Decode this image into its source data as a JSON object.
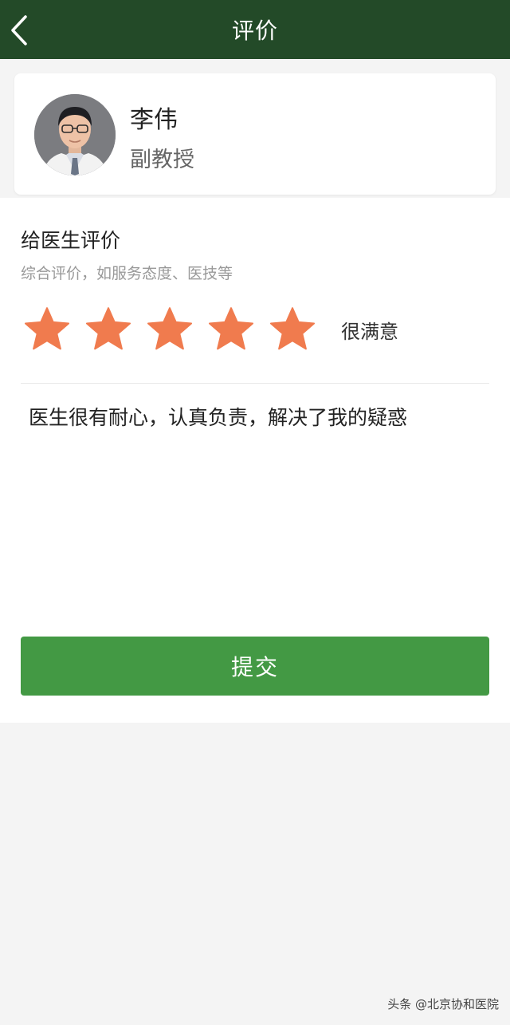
{
  "header": {
    "title": "评价",
    "back_icon": "chevron-left-icon"
  },
  "doctor": {
    "name": "李伟",
    "title": "副教授"
  },
  "rating": {
    "section_title": "给医生评价",
    "subtitle": "综合评价，如服务态度、医技等",
    "stars_selected": 5,
    "stars_total": 5,
    "star_color": "#f07b4e",
    "label": "很满意"
  },
  "comment": {
    "text": "医生很有耐心，认真负责，解决了我的疑惑"
  },
  "submit": {
    "label": "提交"
  },
  "watermark": "头条 @北京协和医院",
  "colors": {
    "header_bg": "#234a28",
    "submit_bg": "#439944"
  }
}
